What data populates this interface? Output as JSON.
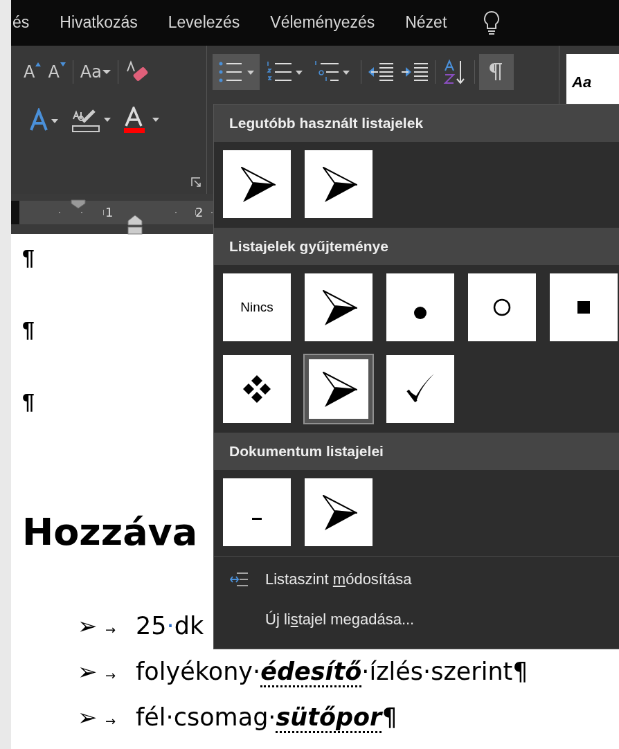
{
  "tabs": [
    {
      "label": "és"
    },
    {
      "label": "Hivatkozás"
    },
    {
      "label": "Levelezés"
    },
    {
      "label": "Véleményezés"
    },
    {
      "label": "Nézet"
    }
  ],
  "ribbon": {
    "row1": [
      {
        "kind": "grow-font",
        "label": "A"
      },
      {
        "kind": "shrink-font",
        "label": "A"
      },
      {
        "kind": "change-case",
        "label": "Aa"
      },
      {
        "kind": "clear-format"
      },
      {
        "kind": "bullets",
        "active": true
      },
      {
        "kind": "numbering",
        "active": false
      },
      {
        "kind": "multilevel",
        "active": false
      },
      {
        "kind": "outdent",
        "active": false
      },
      {
        "kind": "indent",
        "active": false
      },
      {
        "kind": "sort",
        "active": false
      },
      {
        "kind": "pilcrow",
        "active": true
      }
    ],
    "row2": [
      {
        "kind": "text-effects"
      },
      {
        "kind": "highlight"
      },
      {
        "kind": "font-color"
      }
    ],
    "style_preview": "Aa"
  },
  "ruler": {
    "numbers": [
      "1",
      "2"
    ]
  },
  "document": {
    "empty_paragraphs": [
      "¶",
      "¶",
      "¶"
    ],
    "heading": "Hozzáva",
    "list": [
      {
        "bullet": "➢",
        "tab": "→",
        "segments": [
          {
            "text": "25",
            "kind": "plain"
          },
          {
            "text": "·",
            "kind": "space-mark"
          },
          {
            "text": "dk",
            "kind": "plain"
          }
        ]
      },
      {
        "bullet": "➢",
        "tab": "→",
        "segments": [
          {
            "text": "folyékony·",
            "kind": "plain"
          },
          {
            "text": "édesítő",
            "kind": "flagged"
          },
          {
            "text": "·ízlés·szerint¶",
            "kind": "plain"
          }
        ]
      },
      {
        "bullet": "➢",
        "tab": "→",
        "segments": [
          {
            "text": "fél·csomag·",
            "kind": "plain"
          },
          {
            "text": "sütőpor",
            "kind": "flagged"
          },
          {
            "text": "¶",
            "kind": "plain"
          }
        ]
      }
    ]
  },
  "bullet_menu": {
    "sections": [
      {
        "title": "Legutóbb használt listajelek",
        "tiles": [
          {
            "kind": "arrow",
            "selected": false
          },
          {
            "kind": "arrow",
            "selected": false
          }
        ]
      },
      {
        "title": "Listajelek gyűjteménye",
        "tiles": [
          {
            "kind": "none",
            "label": "Nincs",
            "selected": false
          },
          {
            "kind": "arrow",
            "selected": false
          },
          {
            "kind": "dot",
            "selected": false
          },
          {
            "kind": "circle",
            "selected": false
          },
          {
            "kind": "square",
            "selected": false
          },
          {
            "kind": "diamonds",
            "selected": false
          },
          {
            "kind": "arrow",
            "selected": true
          },
          {
            "kind": "check",
            "selected": false
          }
        ]
      },
      {
        "title": "Dokumentum listajelei",
        "tiles": [
          {
            "kind": "dash",
            "selected": false
          },
          {
            "kind": "arrow",
            "selected": false
          }
        ]
      }
    ],
    "items": [
      {
        "kind": "level",
        "label_before": "Listaszint ",
        "access_key": "m",
        "label_after": "ódosítása"
      },
      {
        "kind": "plain",
        "label_before": "Új li",
        "access_key": "s",
        "label_after": "tajel megadása..."
      }
    ]
  }
}
